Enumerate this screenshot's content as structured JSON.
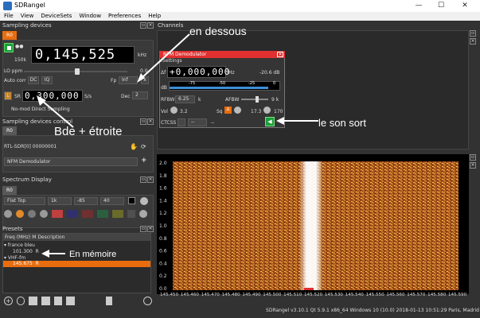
{
  "window": {
    "title": "SDRangel",
    "minimize": "—",
    "maximize": "☐",
    "close": "✕"
  },
  "menu": [
    "File",
    "View",
    "DeviceSets",
    "Window",
    "Preferences",
    "Help"
  ],
  "sampling_devices": {
    "title": "Sampling devices",
    "tab": "R0",
    "frequency": "0,145,525",
    "freq_unit": "kHz",
    "rate": "150k",
    "lo_ppm_label": "LO ppm",
    "lo_ppm_value": "0.0",
    "auto_corr_label": "Auto corr",
    "dc_btn": "DC",
    "iq_btn": "IQ",
    "fp_label": "Fp",
    "fp_value": "Inf",
    "x_btn": "x",
    "l_btn": "L",
    "sr_label": "SR",
    "sr_value": "0,300,000",
    "sr_unit": "S/s",
    "dec_label": "Dec",
    "dec_value": "2",
    "direct_sampling": "No-mod Direct Sampling"
  },
  "device_control": {
    "title": "Sampling devices control",
    "tab": "R0",
    "device": "RTL-SDR[0] 00000001",
    "demod": "NFM Demodulator"
  },
  "spectrum_display": {
    "title": "Spectrum Display",
    "tab": "R0",
    "window_fn": "Flat Top",
    "fft": "1k",
    "ref": "-85",
    "range": "40"
  },
  "presets": {
    "title": "Presets",
    "col_freq": "Freq (MHz)",
    "col_mode": "M",
    "col_desc": "Description",
    "items": [
      {
        "group": "france bleu",
        "freq": "101.300",
        "mode": "R"
      },
      {
        "group": "VHF-fm",
        "freq": "145.675",
        "mode": "R"
      }
    ]
  },
  "channels": {
    "title": "Channels"
  },
  "nfm": {
    "title": "NFM Demodulator",
    "settings": "Settings",
    "delta_f_label": "Δf",
    "delta_f": "+0,000,000",
    "hz": "Hz",
    "db_val": "-20.6 dB",
    "db_label": "dB",
    "scale": [
      "-75",
      "-50",
      "-25",
      "0"
    ],
    "rfbw_label": "RFBW",
    "rfbw": "6.25",
    "k": "k",
    "afbw_label": "AFBW",
    "afbw": "9 k",
    "vol_label": "Vol",
    "vol": "3.2",
    "sq_label": "Sq",
    "sq_val": "17.3",
    "sq_extra": "170",
    "ctcss_label": "CTCSS",
    "ctcss_val": "--",
    "ctcss_dots": "--"
  },
  "waterfall": {
    "y_ticks": [
      "2.0",
      "1.8",
      "1.6",
      "1.4",
      "1.2",
      "1.0",
      "0.8",
      "0.6",
      "0.4",
      "0.2",
      "0.0"
    ],
    "x_ticks": [
      "145.450",
      "145.460",
      "145.470",
      "145.480",
      "145.490",
      "145.500",
      "145.510",
      "145.520",
      "145.530",
      "145.540",
      "145.550",
      "145.560",
      "145.570",
      "145.580",
      "145.590"
    ]
  },
  "annotations": {
    "dessous": "en dessous",
    "bde": "Bde + étroite",
    "son": "le son sort",
    "memoire": "En mémoire"
  },
  "status": "SDRangel v3.10.1  Qt 5.9.1  x86_64 Windows 10 (10.0)  2018-01-13 10:51:29 Paris, Madrid",
  "colors": {
    "accent": "#e96d0f",
    "panel": "#323232",
    "nfm_title": "#e03030"
  }
}
